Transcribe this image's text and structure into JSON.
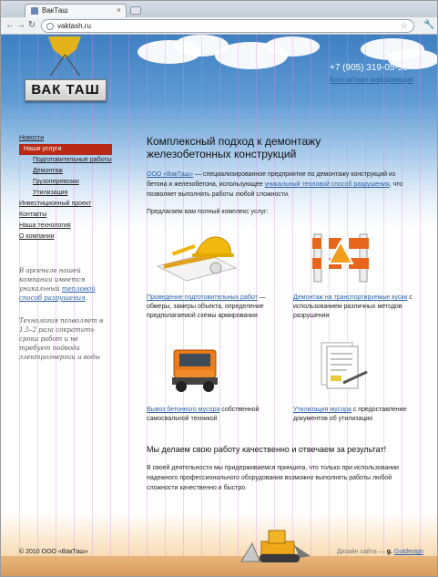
{
  "browser": {
    "tab_title": "ВакТаш",
    "url": "vaktash.ru"
  },
  "header": {
    "logo_text": "ВАК ТАШ",
    "phone": "+7 (905) 319-05-50",
    "contact_link": "Контактная информация"
  },
  "sidebar": {
    "items": [
      {
        "label": "Новости",
        "level": 0,
        "active": false
      },
      {
        "label": "Наши услуги",
        "level": 0,
        "active": true
      },
      {
        "label": "Подготовительные работы",
        "level": 1,
        "active": false
      },
      {
        "label": "Демонтаж",
        "level": 1,
        "active": false
      },
      {
        "label": "Грузоперевозки",
        "level": 1,
        "active": false
      },
      {
        "label": "Утилизация",
        "level": 1,
        "active": false
      },
      {
        "label": "Инвестиционный проект",
        "level": 0,
        "active": false
      },
      {
        "label": "Контакты",
        "level": 0,
        "active": false
      },
      {
        "label": "Наша технология",
        "level": 0,
        "active": false
      },
      {
        "label": "О компании",
        "level": 0,
        "active": false
      }
    ],
    "note1_before": "В арсенале нашей компании имеется уникальный ",
    "note1_link": "тепловой способ разрушения",
    "note1_after": ".",
    "note2": "Технология позволяет в 1,5–2 раза сократить сроки работ и не требует подвода электроэнергии и воды"
  },
  "main": {
    "title": "Комплексный подход к демонтажу железобетонных конструкций",
    "intro_link1": "ООО «ВакТаш»",
    "intro_text1": " — специализированное предприятие по демонтажу конструкций из бетона и железобетона, использующее ",
    "intro_link2": "уникальный тепловой способ разрушения",
    "intro_text2": ", что позволяет выполнять работы любой сложности.",
    "offer": "Предлагаем вам полный комплекс услуг:",
    "services": [
      {
        "link": "Проведение подготовительных работ",
        "text": " — обмеры, замеры объекта, определение предполагаемой схемы армирования",
        "icon": "hardhat-tools-icon"
      },
      {
        "link": "Демонтаж на транспортируемые куски",
        "text": " с использованием различных методов разрушения",
        "icon": "road-barrier-icon"
      },
      {
        "link": "Вывоз бетонного мусора",
        "text": " собственной самосвальной техникой",
        "icon": "dump-truck-icon"
      },
      {
        "link": "Утилизация мусора",
        "text": " с предоставление документов об утилизации",
        "icon": "documents-pen-icon"
      }
    ],
    "subtitle": "Мы делаем свою работу качественно и отвечаем за результат!",
    "closing": "В своей деятельности мы придерживаемся принципа, что только при использовании надежного профессионального оборудования возможно выполнять работы любой сложности качественно и быстро."
  },
  "footer": {
    "copyright": "© 2010 ООО «ВакТаш»",
    "design_label": "Дизайн сайта —",
    "design_mark": "g.",
    "design_link": "Gutdesign"
  },
  "colors": {
    "accent_red": "#b82a16",
    "link_blue": "#2b5fa6",
    "sky_blue": "#5f9bd3"
  }
}
